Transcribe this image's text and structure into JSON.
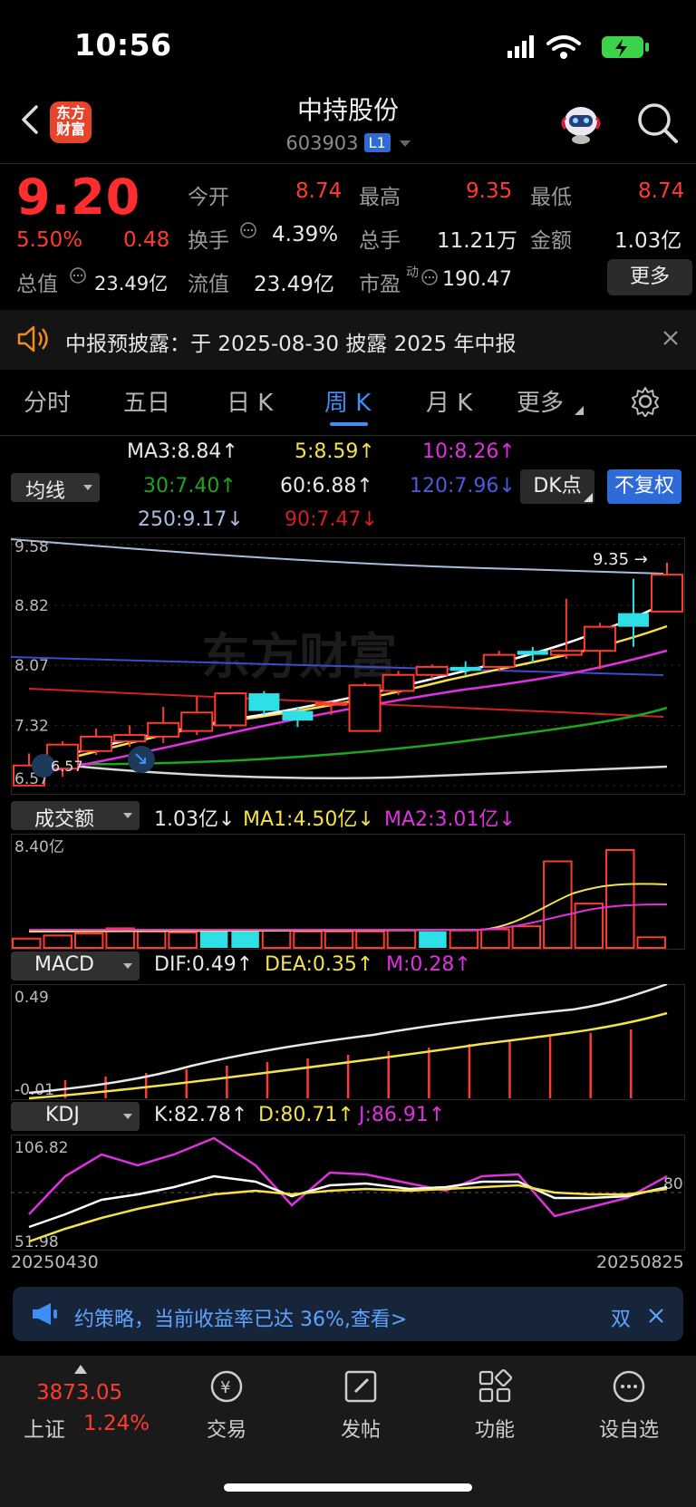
{
  "status_bar": {
    "time": "10:56"
  },
  "header": {
    "stock_name": "中持股份",
    "stock_code": "603903",
    "level_badge": "L1",
    "logo_text_1": "东方",
    "logo_text_2": "财富"
  },
  "quote": {
    "price": "9.20",
    "change_pct": "5.50%",
    "change": "0.48",
    "open_label": "今开",
    "open": "8.74",
    "high_label": "最高",
    "high": "9.35",
    "low_label": "最低",
    "low": "8.74",
    "turnover_label": "换手",
    "turnover": "4.39%",
    "volume_label": "总手",
    "volume": "11.21万",
    "amount_label": "金额",
    "amount": "1.03亿",
    "total_cap_label": "总值",
    "total_cap": "23.49亿",
    "float_cap_label": "流值",
    "float_cap": "23.49亿",
    "pe_label": "市盈",
    "pe_sup": "动",
    "pe": "190.47",
    "more_button": "更多"
  },
  "notice": {
    "text": "中报预披露：于 2025-08-30 披露 2025 年中报"
  },
  "tabs": [
    "分时",
    "五日",
    "日 K",
    "周 K",
    "月 K",
    "更多"
  ],
  "active_tab": "周 K",
  "ma_panel": {
    "dropdown": "均线",
    "ma3": "MA3:8.84",
    "ma3_dir": "↑",
    "ma5": "5:8.59",
    "ma5_dir": "↑",
    "ma10": "10:8.26",
    "ma10_dir": "↑",
    "ma30": "30:7.40",
    "ma30_dir": "↑",
    "ma60": "60:6.88",
    "ma60_dir": "↑",
    "ma120": "120:7.96",
    "ma120_dir": "↓",
    "ma250": "250:9.17",
    "ma250_dir": "↓",
    "ma90": "90:7.47",
    "ma90_dir": "↓",
    "dk_button": "DK点",
    "adjust_button": "不复权"
  },
  "colors": {
    "up": "#ff3b30",
    "down": "#2ee0e6",
    "ma3": "#ffffff",
    "ma5": "#f5e14a",
    "ma10": "#e030e0",
    "ma30": "#1fa51f",
    "ma60": "#d8d8d8",
    "ma120": "#3c4bd0",
    "ma250": "#a9bde0",
    "ma90": "#d42020"
  },
  "chart_data": {
    "type": "candlestick",
    "period": "weekly",
    "x_start": "20250430",
    "x_end": "20250825",
    "price_axis_ticks": [
      "9.58",
      "8.82",
      "8.07",
      "7.32",
      "6.57"
    ],
    "max_marker": "9.35",
    "min_marker": "6.57",
    "candles": [
      {
        "o": 6.57,
        "c": 6.82,
        "h": 6.97,
        "l": 6.57,
        "dir": "up"
      },
      {
        "o": 6.78,
        "c": 7.08,
        "h": 7.12,
        "l": 6.68,
        "dir": "up"
      },
      {
        "o": 7.0,
        "c": 7.18,
        "h": 7.28,
        "l": 6.95,
        "dir": "up"
      },
      {
        "o": 7.12,
        "c": 7.2,
        "h": 7.32,
        "l": 7.05,
        "dir": "up"
      },
      {
        "o": 7.18,
        "c": 7.35,
        "h": 7.55,
        "l": 7.1,
        "dir": "up"
      },
      {
        "o": 7.25,
        "c": 7.48,
        "h": 7.68,
        "l": 7.2,
        "dir": "up"
      },
      {
        "o": 7.32,
        "c": 7.72,
        "h": 7.72,
        "l": 7.28,
        "dir": "up"
      },
      {
        "o": 7.72,
        "c": 7.5,
        "h": 7.75,
        "l": 7.45,
        "dir": "down"
      },
      {
        "o": 7.5,
        "c": 7.38,
        "h": 7.55,
        "l": 7.3,
        "dir": "down"
      },
      {
        "o": 7.58,
        "c": 7.6,
        "h": 7.62,
        "l": 7.45,
        "dir": "up"
      },
      {
        "o": 7.25,
        "c": 7.82,
        "h": 7.85,
        "l": 7.25,
        "dir": "up"
      },
      {
        "o": 7.75,
        "c": 7.95,
        "h": 8.0,
        "l": 7.7,
        "dir": "up"
      },
      {
        "o": 7.95,
        "c": 8.05,
        "h": 8.08,
        "l": 7.9,
        "dir": "up"
      },
      {
        "o": 8.05,
        "c": 8.0,
        "h": 8.12,
        "l": 7.95,
        "dir": "down"
      },
      {
        "o": 8.05,
        "c": 8.2,
        "h": 8.25,
        "l": 8.0,
        "dir": "up"
      },
      {
        "o": 8.25,
        "c": 8.2,
        "h": 8.3,
        "l": 8.1,
        "dir": "down"
      },
      {
        "o": 8.2,
        "c": 8.25,
        "h": 8.9,
        "l": 8.15,
        "dir": "up"
      },
      {
        "o": 8.25,
        "c": 8.55,
        "h": 8.6,
        "l": 8.02,
        "dir": "up"
      },
      {
        "o": 8.72,
        "c": 8.55,
        "h": 9.15,
        "l": 8.3,
        "dir": "down"
      },
      {
        "o": 8.74,
        "c": 9.2,
        "h": 9.35,
        "l": 8.74,
        "dir": "up"
      }
    ],
    "volume": {
      "label": "成交额",
      "value": "1.03亿",
      "value_dir": "↓",
      "ma1": "MA1:4.50亿",
      "ma1_dir": "↓",
      "ma2": "MA2:3.01亿",
      "ma2_dir": "↓",
      "top_tick": "8.40亿",
      "bars": [
        0.9,
        1.2,
        1.4,
        1.9,
        1.6,
        1.5,
        1.6,
        1.7,
        1.7,
        1.6,
        1.6,
        1.6,
        1.7,
        1.6,
        1.7,
        1.8,
        2.1,
        8.4,
        4.3,
        9.5,
        1.03
      ]
    },
    "macd": {
      "label": "MACD",
      "dif": "DIF:0.49",
      "dif_dir": "↑",
      "dea": "DEA:0.35",
      "dea_dir": "↑",
      "m": "M:0.28",
      "m_dir": "↑",
      "top_tick": "0.49",
      "bottom_tick": "-0.01"
    },
    "kdj": {
      "label": "KDJ",
      "k": "K:82.78",
      "k_dir": "↑",
      "d": "D:80.71",
      "d_dir": "↑",
      "j": "J:86.91",
      "j_dir": "↑",
      "top_tick": "106.82",
      "bottom_tick": "51.98",
      "mark": "80"
    }
  },
  "promo": {
    "text": "约策略，当前收益率已达 36%,查看>",
    "tail": "双"
  },
  "bottom_nav": {
    "index_value": "3873.05",
    "index_name": "上证",
    "index_change": "1.24%",
    "trade": "交易",
    "post": "发帖",
    "func": "功能",
    "watch": "设自选"
  }
}
